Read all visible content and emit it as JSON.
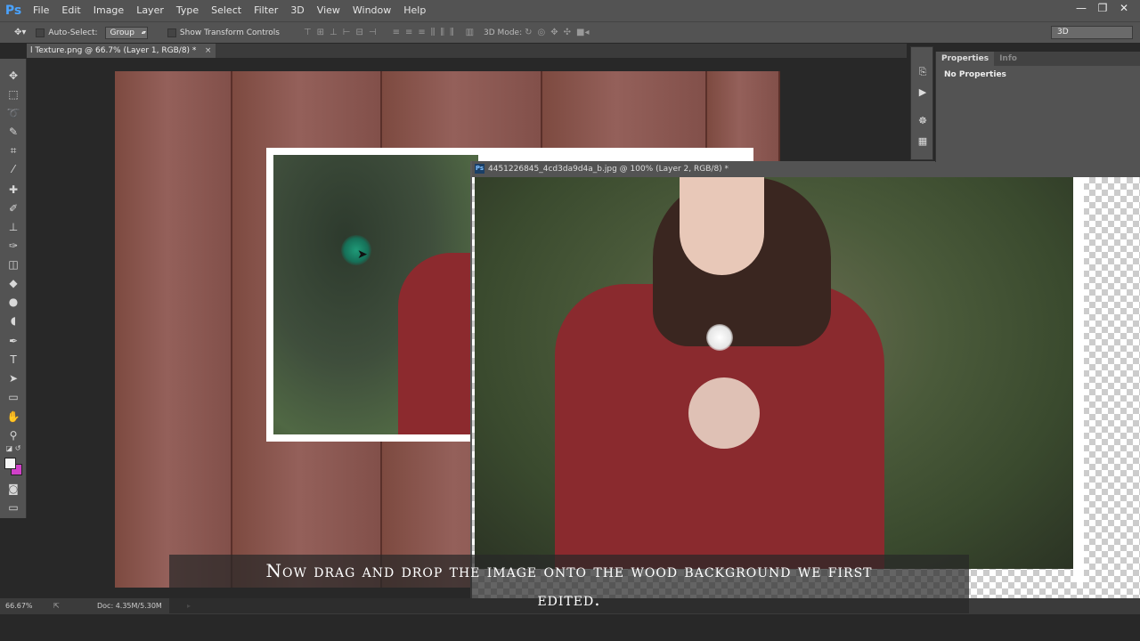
{
  "app": {
    "logo": "Ps",
    "menu": [
      "File",
      "Edit",
      "Image",
      "Layer",
      "Type",
      "Select",
      "Filter",
      "3D",
      "View",
      "Window",
      "Help"
    ],
    "window_controls": [
      "—",
      "❐",
      "✕"
    ]
  },
  "options_bar": {
    "auto_select_label": "Auto-Select:",
    "auto_select_target": "Group",
    "show_transform_label": "Show Transform Controls",
    "three_d_mode_label": "3D Mode:",
    "workspace": "3D"
  },
  "document_tab": {
    "title": "l Texture.png @ 66.7% (Layer 1, RGB/8) *",
    "close": "×"
  },
  "floating_window": {
    "icon": "Ps",
    "title": "4451226845_4cd3da9d4a_b.jpg @ 100% (Layer 2, RGB/8) *"
  },
  "properties_panel": {
    "tabs": [
      "Properties",
      "Info"
    ],
    "content": "No Properties"
  },
  "status_bar": {
    "zoom": "66.67%",
    "doc_info": "Doc: 4.35M/5.30M"
  },
  "caption": {
    "line1": "Now drag and drop the image onto the wood background we first",
    "line2": "edited."
  },
  "colors": {
    "foreground": "#f5f5f5",
    "background": "#d040c8",
    "accent": "#4aa3ff"
  }
}
